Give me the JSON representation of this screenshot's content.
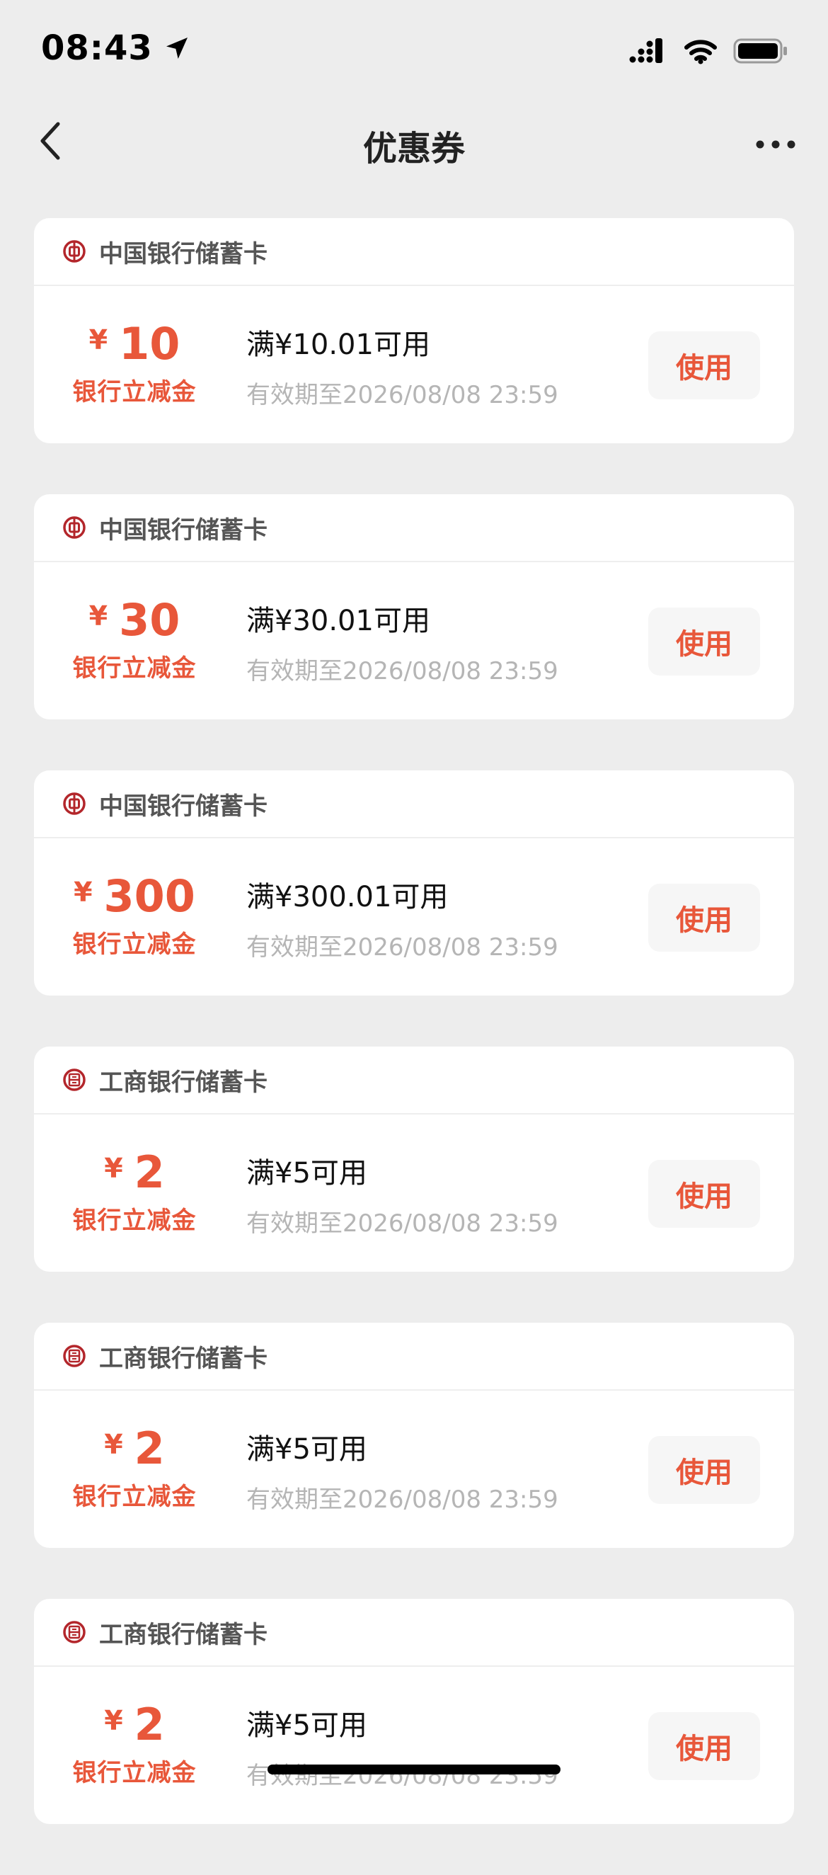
{
  "status_bar": {
    "time": "08:43"
  },
  "nav": {
    "title": "优惠券"
  },
  "coupons": [
    {
      "bank": "中国银行储蓄卡",
      "bank_icon": "boc-logo-icon",
      "currency": "¥",
      "amount": "10",
      "type": "银行立减金",
      "condition": "满¥10.01可用",
      "validity": "有效期至2026/08/08 23:59",
      "button": "使用"
    },
    {
      "bank": "中国银行储蓄卡",
      "bank_icon": "boc-logo-icon",
      "currency": "¥",
      "amount": "30",
      "type": "银行立减金",
      "condition": "满¥30.01可用",
      "validity": "有效期至2026/08/08 23:59",
      "button": "使用"
    },
    {
      "bank": "中国银行储蓄卡",
      "bank_icon": "boc-logo-icon",
      "currency": "¥",
      "amount": "300",
      "type": "银行立减金",
      "condition": "满¥300.01可用",
      "validity": "有效期至2026/08/08 23:59",
      "button": "使用"
    },
    {
      "bank": "工商银行储蓄卡",
      "bank_icon": "icbc-logo-icon",
      "currency": "¥",
      "amount": "2",
      "type": "银行立减金",
      "condition": "满¥5可用",
      "validity": "有效期至2026/08/08 23:59",
      "button": "使用"
    },
    {
      "bank": "工商银行储蓄卡",
      "bank_icon": "icbc-logo-icon",
      "currency": "¥",
      "amount": "2",
      "type": "银行立减金",
      "condition": "满¥5可用",
      "validity": "有效期至2026/08/08 23:59",
      "button": "使用"
    },
    {
      "bank": "工商银行储蓄卡",
      "bank_icon": "icbc-logo-icon",
      "currency": "¥",
      "amount": "2",
      "type": "银行立减金",
      "condition": "满¥5可用",
      "validity": "有效期至2026/08/08 23:59",
      "button": "使用"
    }
  ],
  "colors": {
    "accent": "#e8573a",
    "background": "#ededed",
    "card": "#ffffff",
    "muted_text": "#b5b5b5",
    "bank_icon": "#b3262b"
  }
}
